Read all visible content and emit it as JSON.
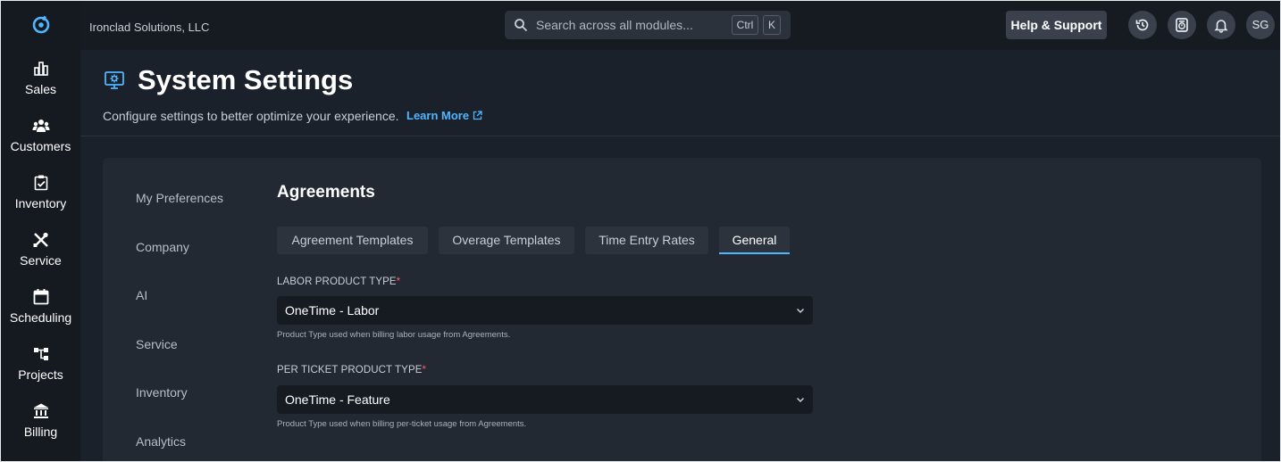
{
  "topbar": {
    "org_name": "Ironclad Solutions, LLC",
    "search_placeholder": "Search across all modules...",
    "shortcut_keys": [
      "Ctrl",
      "K"
    ],
    "help_label": "Help & Support",
    "user_initials": "SG",
    "icons": [
      "history-icon",
      "timer-icon",
      "bell-icon"
    ]
  },
  "rail": {
    "items": [
      {
        "label": "Sales",
        "icon": "chart-bar-icon"
      },
      {
        "label": "Customers",
        "icon": "users-icon"
      },
      {
        "label": "Inventory",
        "icon": "clipboard-check-icon"
      },
      {
        "label": "Service",
        "icon": "tools-icon"
      },
      {
        "label": "Scheduling",
        "icon": "calendar-icon"
      },
      {
        "label": "Projects",
        "icon": "hierarchy-icon"
      },
      {
        "label": "Billing",
        "icon": "bank-icon"
      }
    ]
  },
  "page": {
    "title": "System Settings",
    "subtitle": "Configure settings to better optimize your experience.",
    "learn_more": "Learn More"
  },
  "settings_nav": [
    "My Preferences",
    "Company",
    "AI",
    "Service",
    "Inventory",
    "Analytics"
  ],
  "section": {
    "title": "Agreements",
    "tabs": [
      {
        "label": "Agreement Templates",
        "active": false
      },
      {
        "label": "Overage Templates",
        "active": false
      },
      {
        "label": "Time Entry Rates",
        "active": false
      },
      {
        "label": "General",
        "active": true
      }
    ],
    "fields": [
      {
        "label": "LABOR PRODUCT TYPE",
        "required_mark": "*",
        "value": "OneTime - Labor",
        "hint": "Product Type used when billing labor usage from Agreements."
      },
      {
        "label": "PER TICKET PRODUCT TYPE",
        "required_mark": "*",
        "value": "OneTime - Feature",
        "hint": "Product Type used when billing per-ticket usage from Agreements."
      }
    ]
  },
  "colors": {
    "accent": "#4fb6ff",
    "required": "#ff5a6a",
    "background": "#161b22",
    "card": "#222933"
  }
}
